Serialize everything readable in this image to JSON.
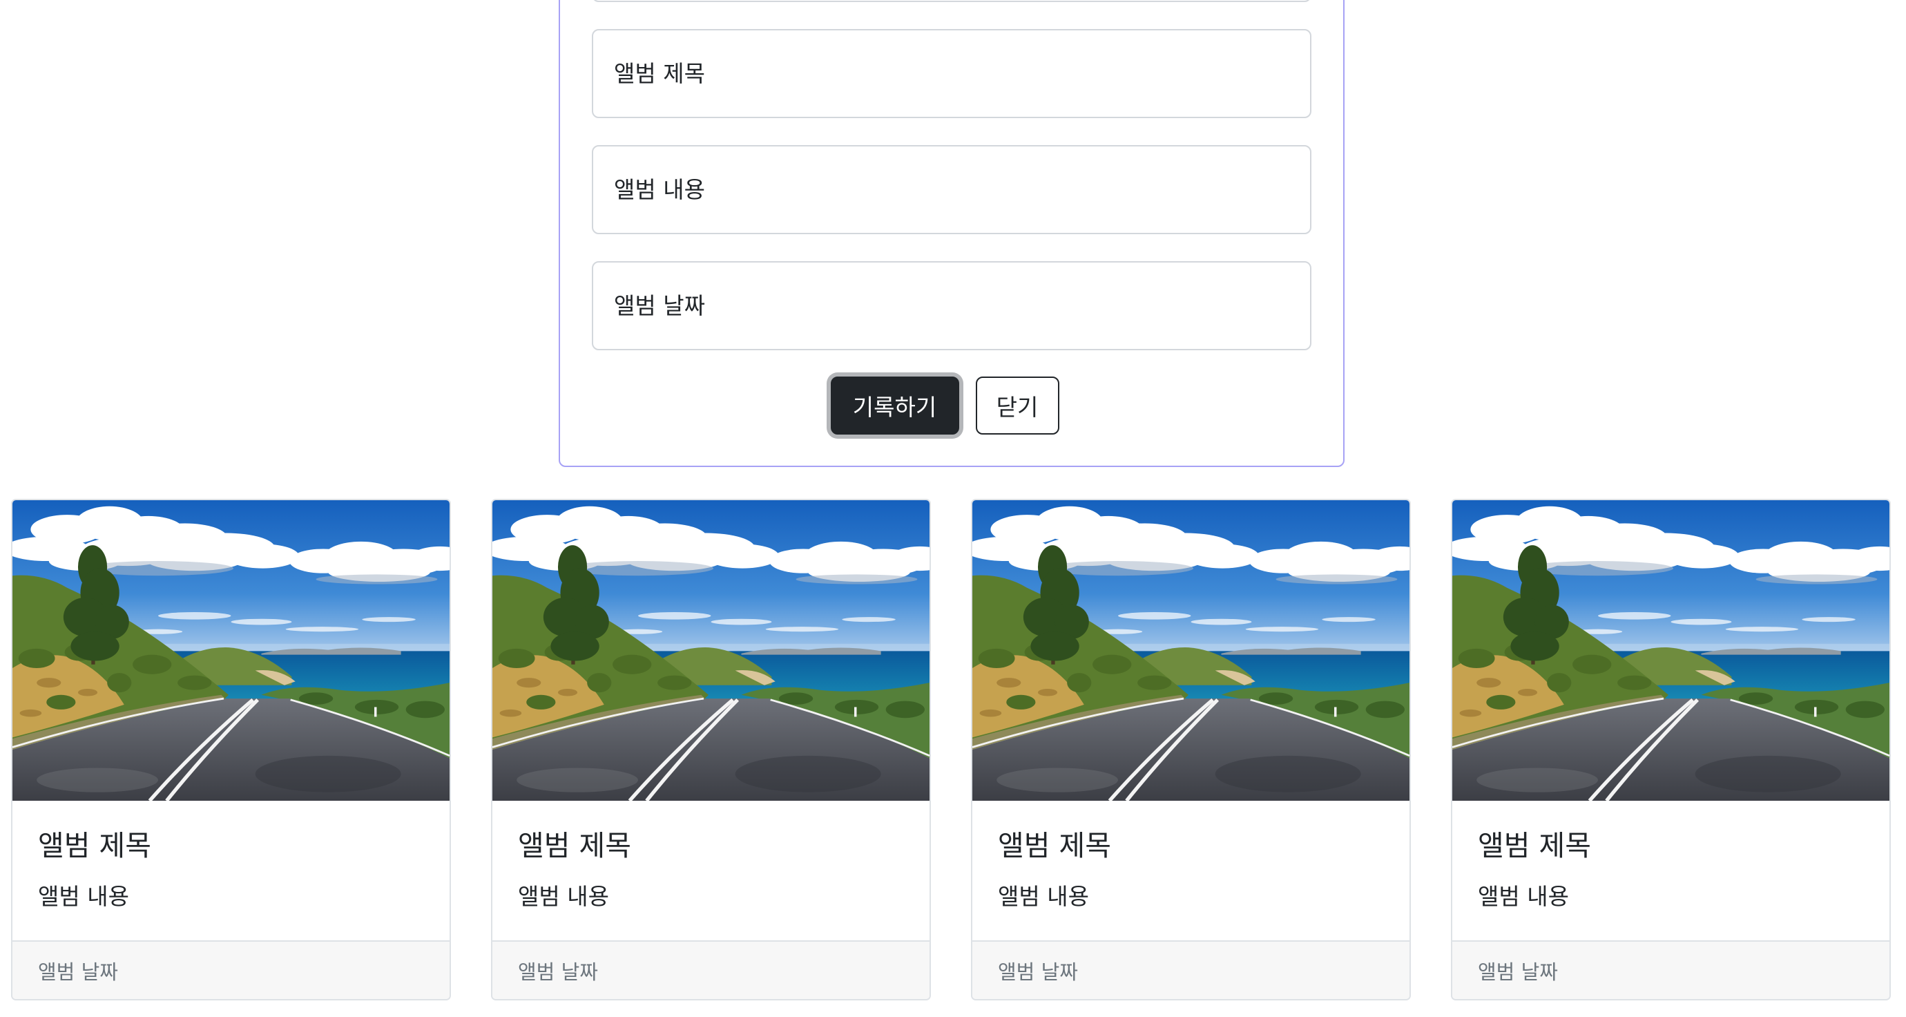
{
  "theme": {
    "panel_border": "#a7a2f5",
    "primary_button": "#212529",
    "muted_text": "#6c757d"
  },
  "form": {
    "title_field": {
      "placeholder": "앨범 제목"
    },
    "content_field": {
      "placeholder": "앨범 내용"
    },
    "date_field": {
      "placeholder": "앨범 날짜"
    },
    "submit_label": "기록하기",
    "close_label": "닫기"
  },
  "albums": [
    {
      "title": "앨범 제목",
      "text": "앨범 내용",
      "date": "앨범 날짜",
      "image": "coastal-road-photo"
    },
    {
      "title": "앨범 제목",
      "text": "앨범 내용",
      "date": "앨범 날짜",
      "image": "coastal-road-photo"
    },
    {
      "title": "앨범 제목",
      "text": "앨범 내용",
      "date": "앨범 날짜",
      "image": "coastal-road-photo"
    },
    {
      "title": "앨범 제목",
      "text": "앨범 내용",
      "date": "앨범 날짜",
      "image": "coastal-road-photo"
    }
  ]
}
